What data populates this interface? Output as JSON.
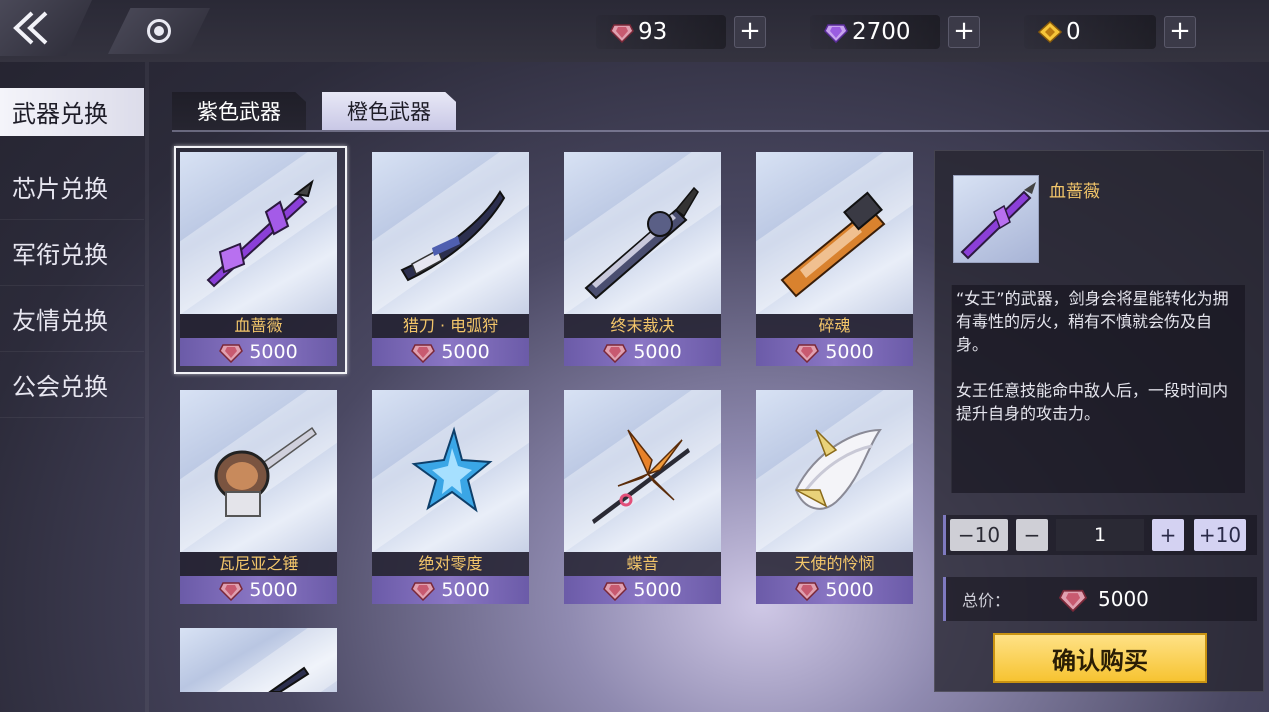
{
  "currencies": [
    {
      "icon": "red-crystal-icon",
      "value": "93"
    },
    {
      "icon": "purple-crystal-icon",
      "value": "2700"
    },
    {
      "icon": "gold-coin-icon",
      "value": "0"
    }
  ],
  "plus_label": "+",
  "sidebar": {
    "items": [
      {
        "label": "武器兑换",
        "active": true
      },
      {
        "label": "芯片兑换",
        "active": false
      },
      {
        "label": "军衔兑换",
        "active": false
      },
      {
        "label": "友情兑换",
        "active": false
      },
      {
        "label": "公会兑换",
        "active": false
      }
    ]
  },
  "tabs": [
    {
      "label": "紫色武器",
      "active": false
    },
    {
      "label": "橙色武器",
      "active": true
    }
  ],
  "items": [
    {
      "name": "血蔷薇",
      "price": "5000",
      "color": "#8b3fd8"
    },
    {
      "name": "猎刀 · 电弧狩",
      "price": "5000",
      "color": "#3c3f72"
    },
    {
      "name": "终末裁决",
      "price": "5000",
      "color": "#4a4e70"
    },
    {
      "name": "碎魂",
      "price": "5000",
      "color": "#d9822e"
    },
    {
      "name": "瓦尼亚之锤",
      "price": "5000",
      "color": "#7a5440"
    },
    {
      "name": "绝对零度",
      "price": "5000",
      "color": "#3aa6e6"
    },
    {
      "name": "蝶音",
      "price": "5000",
      "color": "#e8822a"
    },
    {
      "name": "天使的怜悯",
      "price": "5000",
      "color": "#e9d27a"
    }
  ],
  "detail": {
    "name": "血蔷薇",
    "description_1": "“女王”的武器，剑身会将星能转化为拥有毒性的厉火，稍有不慎就会伤及自身。",
    "description_2": "女王任意技能命中敌人后，一段时间内提升自身的攻击力。",
    "minus10_label": "−10",
    "minus_label": "−",
    "quantity": "1",
    "plus_label": "+",
    "plus10_label": "+10",
    "total_label": "总价：",
    "total_value": "5000",
    "buy_label": "确认购买"
  }
}
